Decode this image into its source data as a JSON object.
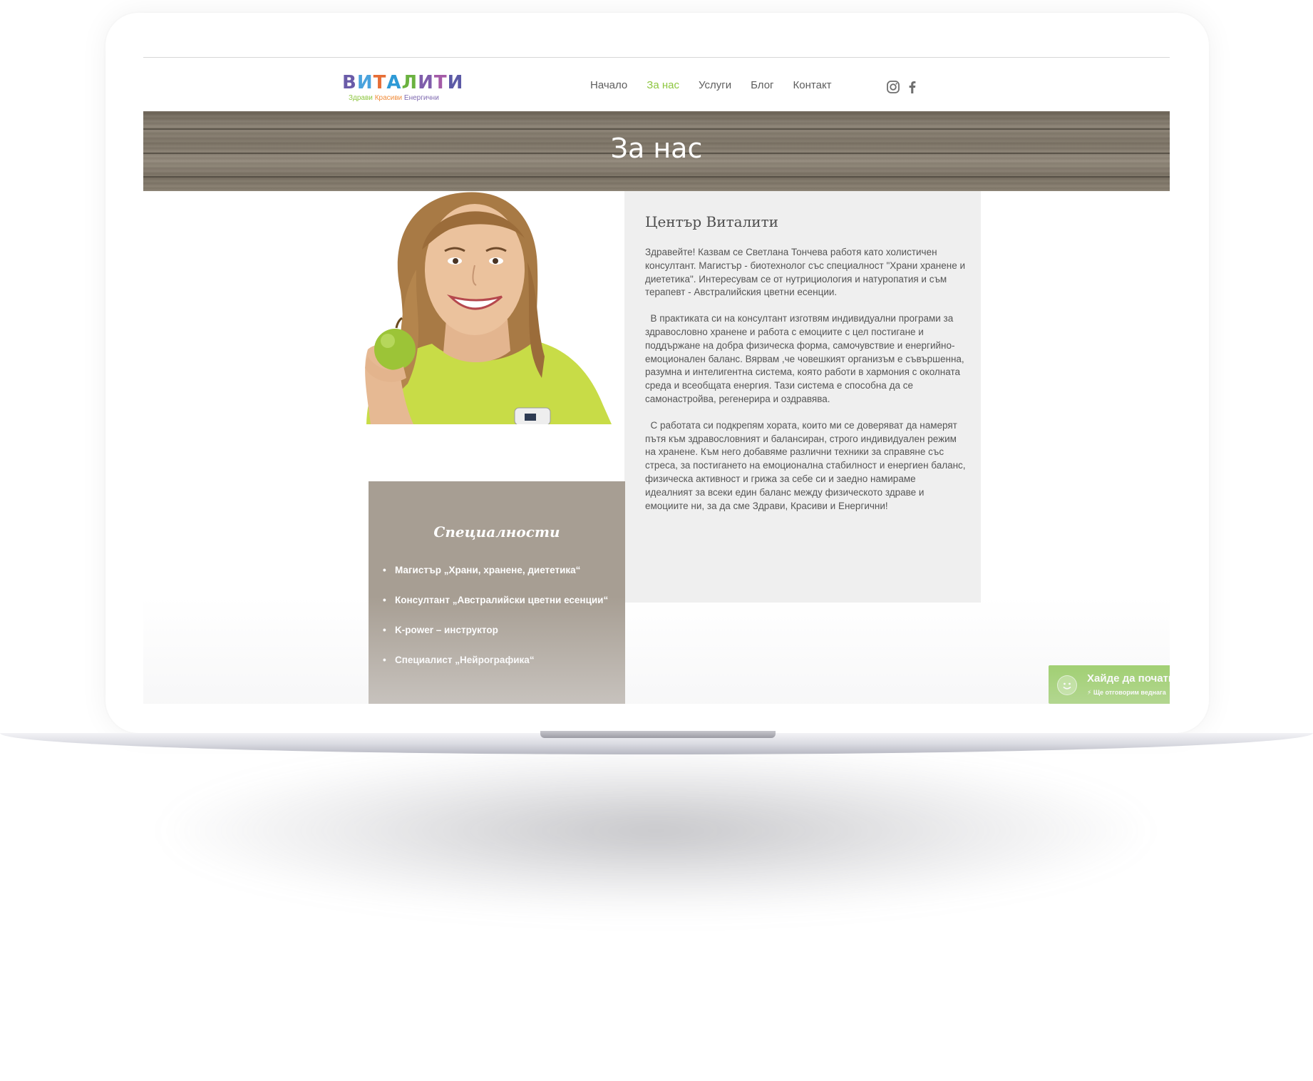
{
  "brand": {
    "logo_letters": [
      "В",
      "И",
      "Т",
      "А",
      "Л",
      "И",
      "Т",
      "И"
    ],
    "logo_colors": [
      "#6a5ba8",
      "#4aa3dd",
      "#e66e36",
      "#2e9ad6",
      "#6bb240",
      "#7f5dab",
      "#a45ba7",
      "#5c5aa6"
    ],
    "tagline": [
      "Здрави",
      "Красиви",
      "Енергични"
    ],
    "tagline_colors": [
      "#8dc63f",
      "#f08c3b",
      "#7f6ab0"
    ]
  },
  "nav": {
    "items": [
      "Начало",
      "За нас",
      "Услуги",
      "Блог",
      "Контакт"
    ],
    "active_index": 1,
    "active_color": "#8dc63f"
  },
  "social": {
    "icons": [
      "instagram-icon",
      "facebook-icon"
    ]
  },
  "banner": {
    "title": "За нас"
  },
  "photo": {
    "description": "photo-of-smiling-woman-holding-green-apple"
  },
  "about": {
    "heading": "Център Виталити",
    "paragraphs": [
      "Здравейте! Казвам се Светлана Тончева работя като холистичен консултант. Магистър - биотехнолог със специалност \"Храни хранене и диететика\". Интересувам се от нутрициология и натуропатия и съм терапевт - Австралийския цветни есенции.",
      "  В практиката си на консултант изготвям индивидуални програми за здравословно хранене и работа с емоциите с цел постигане и поддържане на добра физическа форма, самочувствие и енергийно- емоционален баланс. Вярвам ,че човешкият организъм е съвършенна, разумна и интелигентна система, която работи в хармония с околната среда и всеобщата енергия. Тази система е способна да се самонастройва, регенерира и оздравява.",
      "  С работата си подкрепям хората, които ми се доверяват да намерят пътя към здравословният и балансиран, строго индивидуален режим на хранене. Към него добавяме различни техники за справяне със стреса, за постигането на емоционална стабилност и енергиен баланс, физическа активност и грижа за себе си и заедно намираме идеалният за всеки един баланс между физическото здраве и емоциите ни, за да сме Здрави, Красиви и Енергични!"
    ]
  },
  "specialities": {
    "heading": "Специалности",
    "items": [
      "Магистър „Храни, хранене, диететика“",
      "Консултант  „Австралийски цветни есенции“",
      "K-power – инструктор",
      "Специалист „Нейрографика“"
    ]
  },
  "chat": {
    "title": "Хайде да почати",
    "subtitle": "⚡ Ще отговорим веднага"
  }
}
